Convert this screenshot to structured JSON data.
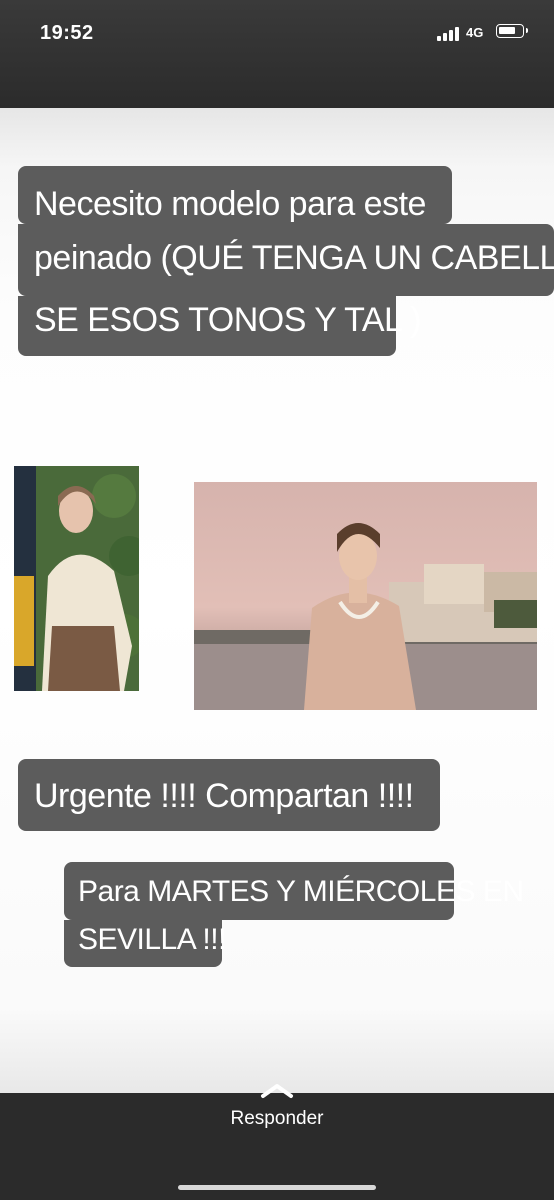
{
  "status_bar": {
    "time": "19:52",
    "network": "4G"
  },
  "story": {
    "caption_top": {
      "line1": "Necesito modelo para este",
      "line2": "peinado (QUÉ TENGA UN CABELLO",
      "line3": "SE ESOS TONOS Y TAL )"
    },
    "caption_urgent": "Urgente !!!! Compartan !!!!",
    "caption_dates": {
      "line1": "Para MARTES Y MIÉRCOLES EN",
      "line2": "SEVILLA !!!"
    }
  },
  "footer": {
    "reply_label": "Responder"
  },
  "colors": {
    "caption_bg": "#5c5c5c",
    "bar_bg": "#2b2b2b"
  }
}
